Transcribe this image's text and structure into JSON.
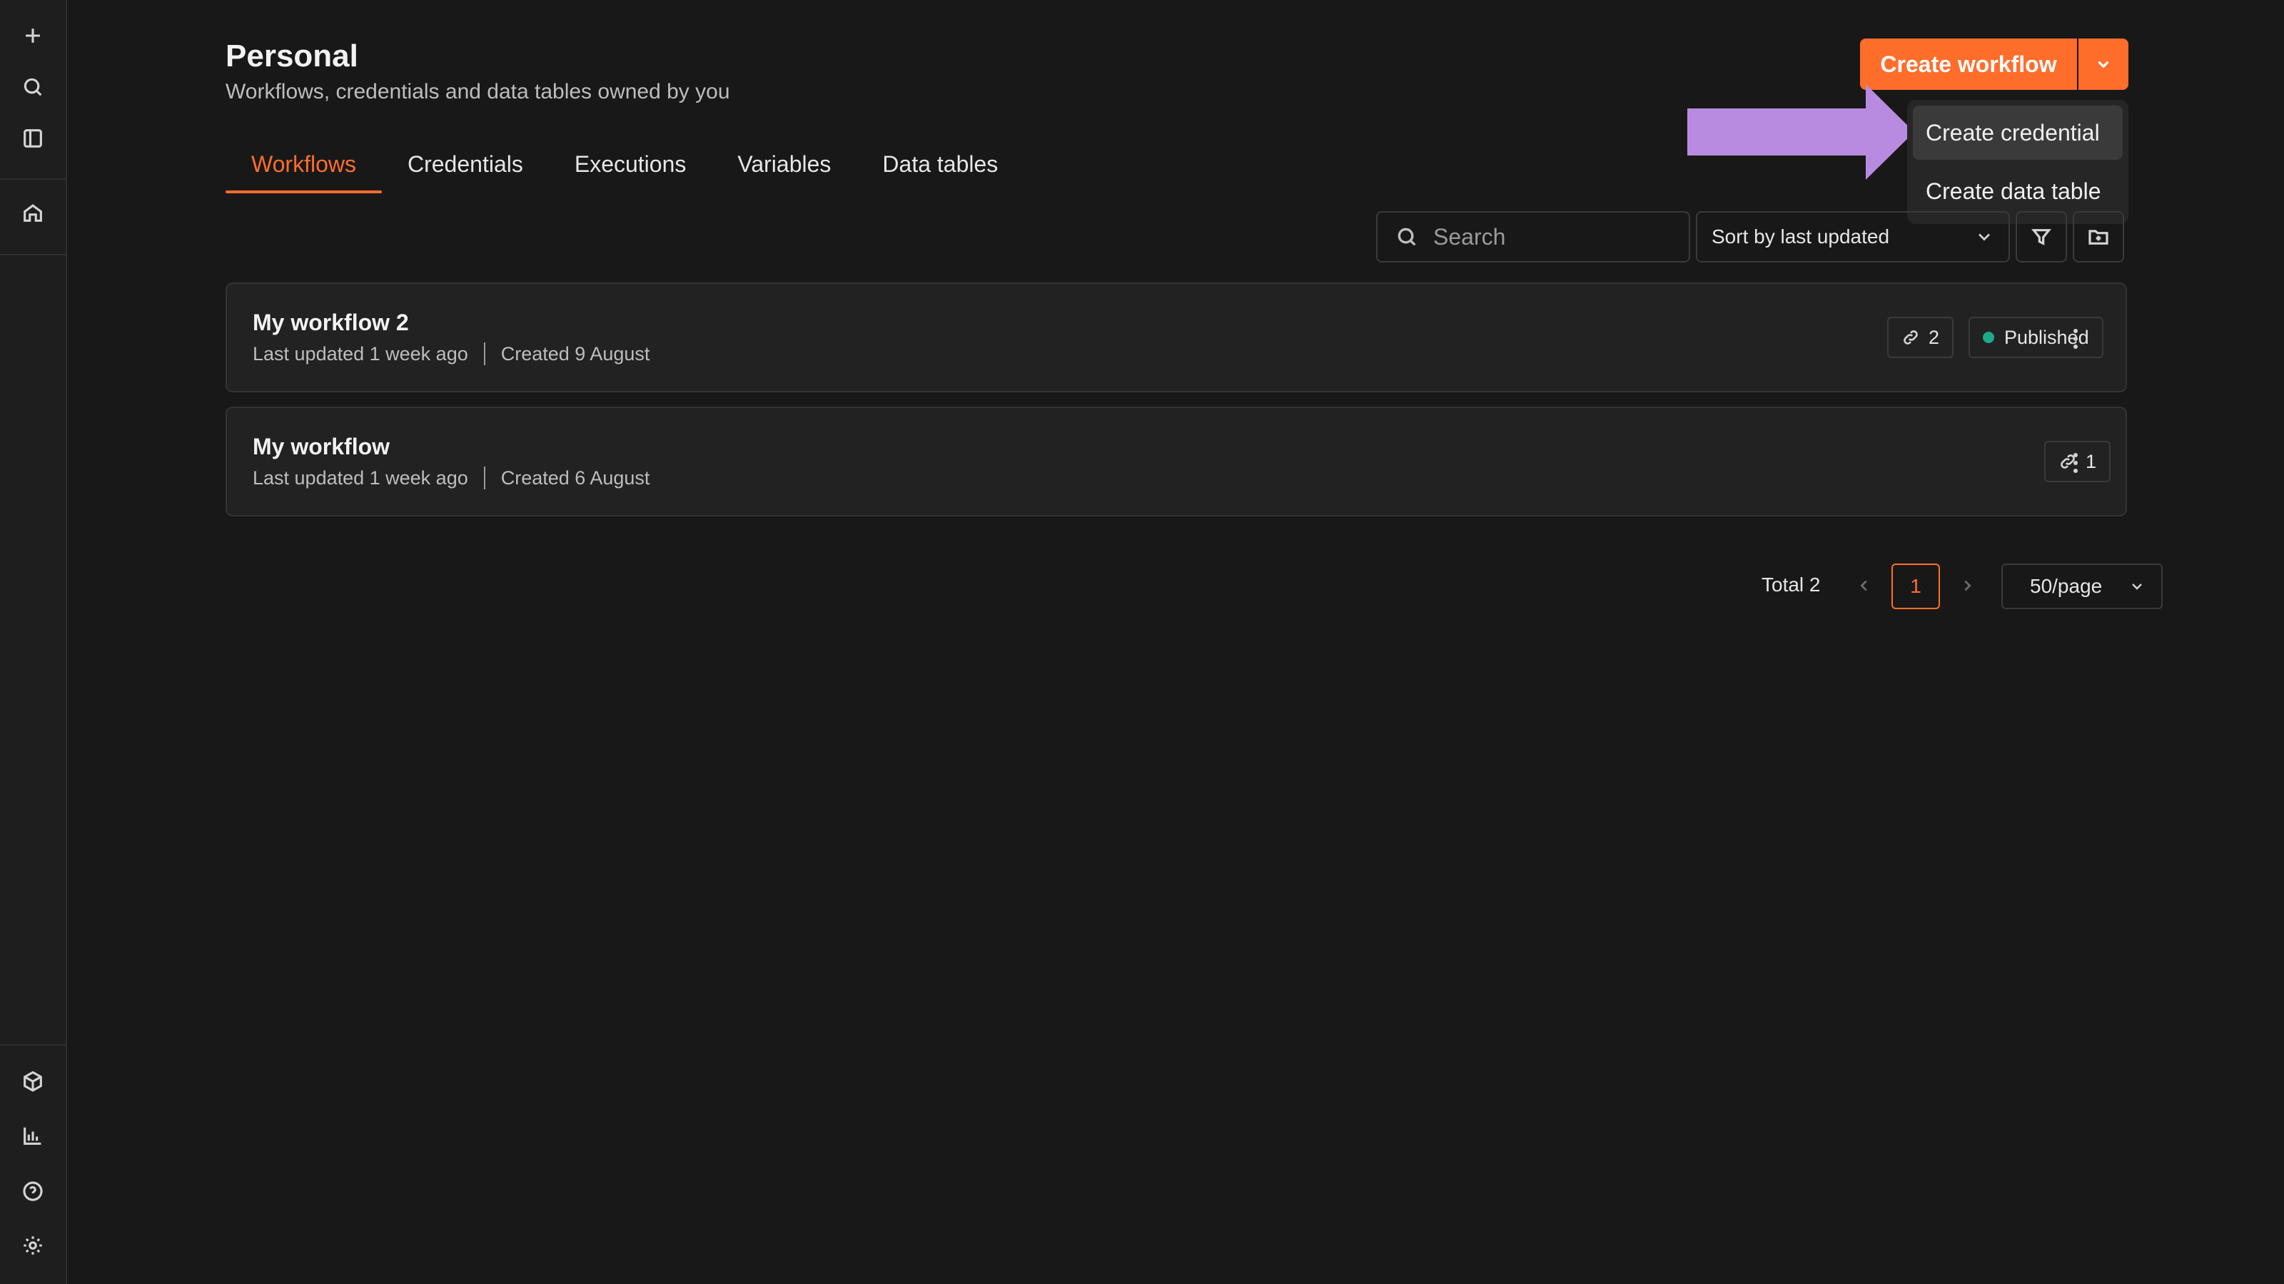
{
  "header": {
    "title": "Personal",
    "subtitle": "Workflows, credentials and data tables owned by you",
    "create_button": "Create workflow"
  },
  "dropdown": {
    "items": [
      {
        "label": "Create credential"
      },
      {
        "label": "Create data table"
      }
    ]
  },
  "tabs": [
    {
      "label": "Workflows",
      "active": true
    },
    {
      "label": "Credentials"
    },
    {
      "label": "Executions"
    },
    {
      "label": "Variables"
    },
    {
      "label": "Data tables"
    }
  ],
  "toolbar": {
    "search_placeholder": "Search",
    "sort_label": "Sort by last updated"
  },
  "workflows": [
    {
      "name": "My workflow 2",
      "last_updated": "Last updated 1 week ago",
      "created": "Created 9 August",
      "links": "2",
      "status": "Published"
    },
    {
      "name": "My workflow",
      "last_updated": "Last updated 1 week ago",
      "created": "Created 6 August",
      "links": "1"
    }
  ],
  "pagination": {
    "total": "Total 2",
    "current_page": "1",
    "page_size": "50/page"
  },
  "sidebar": {
    "icons": [
      "plus-icon",
      "search-icon",
      "panel-icon",
      "home-icon",
      "cube-icon",
      "chart-icon",
      "help-icon",
      "settings-icon"
    ]
  },
  "colors": {
    "accent": "#ff6d2b",
    "published_dot": "#1fa98b",
    "annotation_arrow": "#b98be0",
    "background": "#181818"
  }
}
